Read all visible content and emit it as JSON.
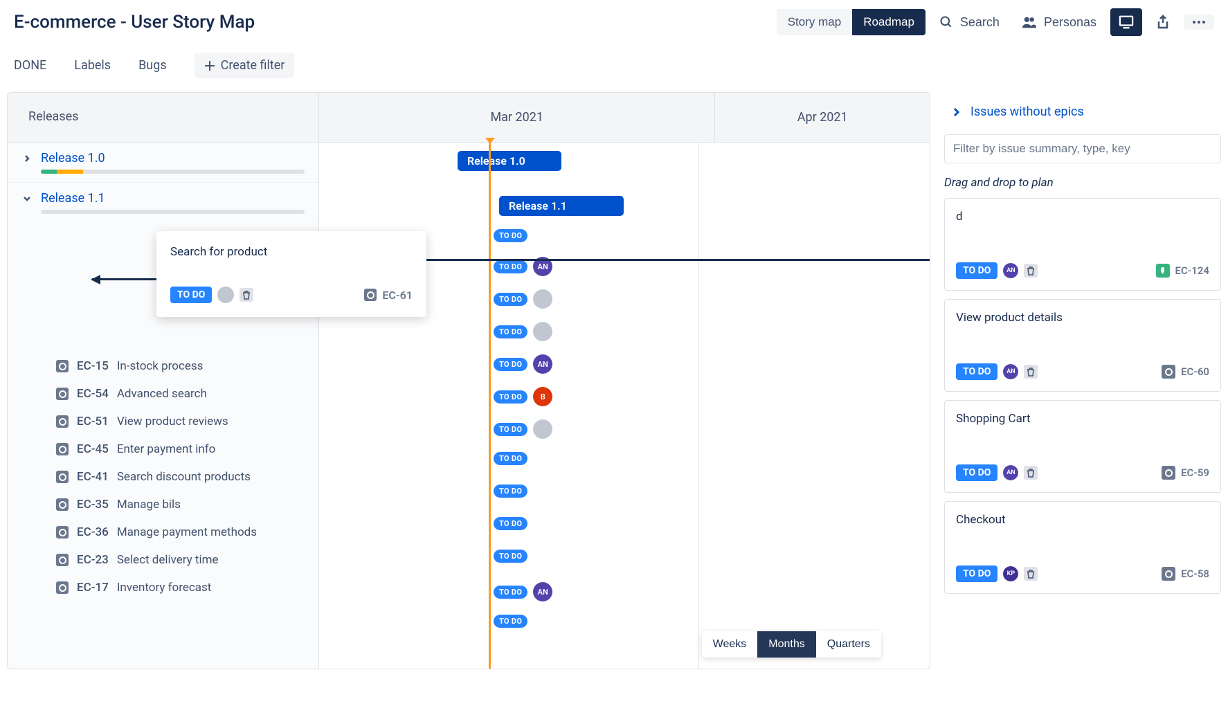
{
  "page_title": "E-commerce - User Story Map",
  "header": {
    "tabs": {
      "story_map": "Story map",
      "roadmap": "Roadmap"
    },
    "search": "Search",
    "personas": "Personas"
  },
  "filters": {
    "done": "DONE",
    "labels": "Labels",
    "bugs": "Bugs",
    "create": "Create filter"
  },
  "roadmap": {
    "releases_label": "Releases",
    "months": [
      "Mar 2021",
      "Apr 2021"
    ],
    "releases": [
      {
        "name": "Release 1.0",
        "expanded": false,
        "bar_label": "Release 1.0"
      },
      {
        "name": "Release 1.1",
        "expanded": true,
        "bar_label": "Release 1.1"
      }
    ],
    "issues": [
      {
        "key": "EC-15",
        "title": "In-stock process"
      },
      {
        "key": "EC-54",
        "title": "Advanced search"
      },
      {
        "key": "EC-51",
        "title": "View product reviews"
      },
      {
        "key": "EC-45",
        "title": "Enter payment info"
      },
      {
        "key": "EC-41",
        "title": "Search discount products"
      },
      {
        "key": "EC-35",
        "title": "Manage bils"
      },
      {
        "key": "EC-36",
        "title": "Manage payment methods"
      },
      {
        "key": "EC-23",
        "title": "Select delivery time"
      },
      {
        "key": "EC-17",
        "title": "Inventory forecast"
      }
    ],
    "todo_label": "TO DO",
    "avatar_an": "AN",
    "avatar_b": "B",
    "time_options": {
      "weeks": "Weeks",
      "months": "Months",
      "quarters": "Quarters"
    }
  },
  "floating_card": {
    "title": "Search for product",
    "status": "TO DO",
    "key": "EC-61"
  },
  "side": {
    "header": "Issues without epics",
    "filter_placeholder": "Filter by issue summary, type, key",
    "hint": "Drag and drop to plan",
    "todo_label": "TO DO",
    "avatar_an": "AN",
    "avatar_kp": "KP",
    "epics": [
      {
        "title": "d",
        "key": "EC-124",
        "avatar": "AN",
        "type": "green"
      },
      {
        "title": "View product details",
        "key": "EC-60",
        "avatar": "AN",
        "type": "gray"
      },
      {
        "title": "Shopping Cart",
        "key": "EC-59",
        "avatar": "AN",
        "type": "gray"
      },
      {
        "title": "Checkout",
        "key": "EC-58",
        "avatar": "KP",
        "type": "gray"
      }
    ]
  }
}
